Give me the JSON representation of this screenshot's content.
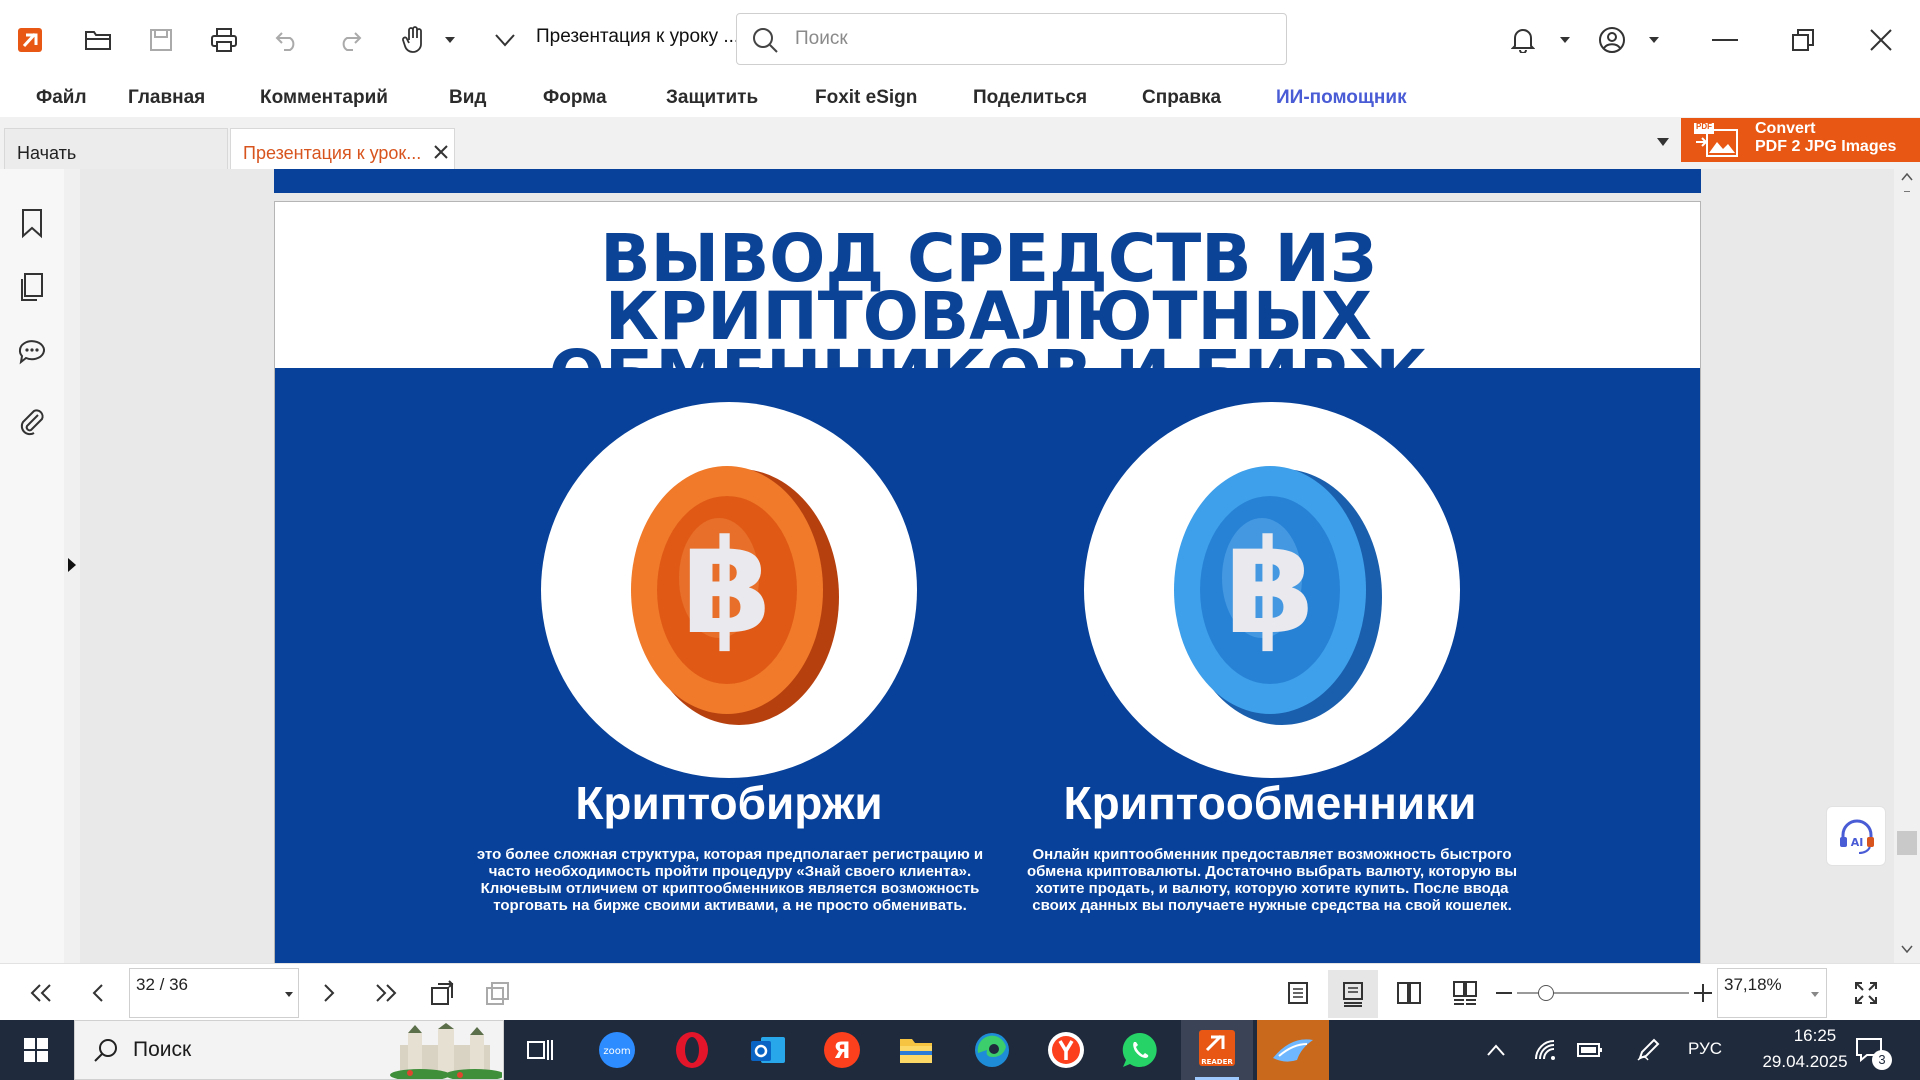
{
  "window": {
    "document_title": "Презентация к уроку ...",
    "search_placeholder": "Поиск"
  },
  "menu": [
    "Файл",
    "Главная",
    "Комментарий",
    "Вид",
    "Форма",
    "Защитить",
    "Foxit eSign",
    "Поделиться",
    "Справка",
    "ИИ-помощник"
  ],
  "tabs": {
    "start": "Начать",
    "active": "Презентация к урок..."
  },
  "promo": {
    "line1": "Convert",
    "line2": "PDF 2 JPG Images",
    "badge": "PDF"
  },
  "slide": {
    "title": "ВЫВОД СРЕДСТВ ИЗ КРИПТОВАЛЮТНЫХ\nОБМЕННИКОВ И БИРЖ",
    "left": {
      "heading": "Криптобиржи",
      "text": "это более сложная структура, которая предполагает регистрацию и часто необходимость пройти процедуру «Знай своего клиента». Ключевым отличием от криптообменников является возможность торговать на бирже своими активами, а не просто обменивать.",
      "coin_symbol": "฿",
      "coin_color": "#e8641a"
    },
    "right": {
      "heading": "Криптообменники",
      "text": "Онлайн криптообменник предоставляет возможность быстрого обмена криптовалюты. Достаточно выбрать валюту, которую вы хотите продать, и валюту, которую хотите купить. После ввода своих данных вы получаете нужные средства на свой кошелек.",
      "coin_symbol": "฿",
      "coin_color": "#2d8ee0"
    },
    "page_number": "32"
  },
  "ai_widget": {
    "label": "AI"
  },
  "status": {
    "page_value": "32 / 36",
    "zoom_value": "37,18%"
  },
  "taskbar": {
    "search_label": "Поиск",
    "apps": [
      "zoom",
      "ЯНДЕКС",
      "READER"
    ],
    "zoom_label": "zoom",
    "yandex_label": "Я",
    "reader_label": "READER",
    "lang": "РУС",
    "time": "16:25",
    "date": "29.04.2025",
    "notification_count": "3"
  },
  "colors": {
    "brand": "#e85713",
    "slide_blue": "#07419a",
    "title_blue": "#0b4497",
    "ai_link": "#4a5bd6"
  }
}
